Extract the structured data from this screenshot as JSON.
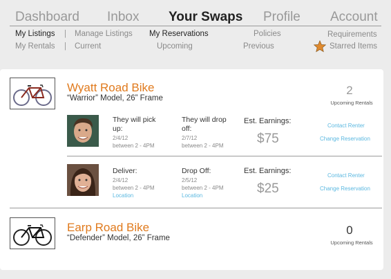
{
  "nav": {
    "tabs": [
      {
        "label": "Dashboard"
      },
      {
        "label": "Inbox"
      },
      {
        "label": "Your Swaps"
      },
      {
        "label": "Profile"
      },
      {
        "label": "Account"
      }
    ],
    "sub_row1": [
      "My Listings",
      "Manage Listings",
      "My Reservations",
      "Policies",
      "Requirements"
    ],
    "sub_row2": [
      "My Rentals",
      "Current",
      "Upcoming",
      "Previous",
      "Starred Items"
    ],
    "separator": "|"
  },
  "listings": [
    {
      "name": "Wyatt Road Bike",
      "model": "“Warrior” Model, 26” Frame",
      "count": "2",
      "count_label": "Upcoming Rentals",
      "reservations": [
        {
          "col1_label": "They will pick up:",
          "col1_date": "2/4/12",
          "col1_time": "between 2 - 4PM",
          "col2_label": "They will drop off:",
          "col2_date": "2/7/12",
          "col2_time": "between 2 - 4PM",
          "earn_label": "Est. Earnings:",
          "earn_value": "$75",
          "link1": "Contact Renter",
          "link2": "Change Reservation"
        },
        {
          "col1_label": "Deliver:",
          "col1_date": "2/4/12",
          "col1_time": "between 2 - 4PM",
          "col1_link": "Location",
          "col2_label": "Drop Off:",
          "col2_date": "2/5/12",
          "col2_time": "between 2 - 4PM",
          "col2_link": "Location",
          "earn_label": "Est. Earnings:",
          "earn_value": "$25",
          "link1": "Contact Renter",
          "link2": "Change Reservation"
        }
      ]
    },
    {
      "name": "Earp Road Bike",
      "model": "“Defender” Model, 26” Frame",
      "count": "0",
      "count_label": "Upcoming Rentals"
    }
  ],
  "colors": {
    "accent": "#e07a1d",
    "link": "#5bb8e0",
    "star": "#e08a2e"
  }
}
